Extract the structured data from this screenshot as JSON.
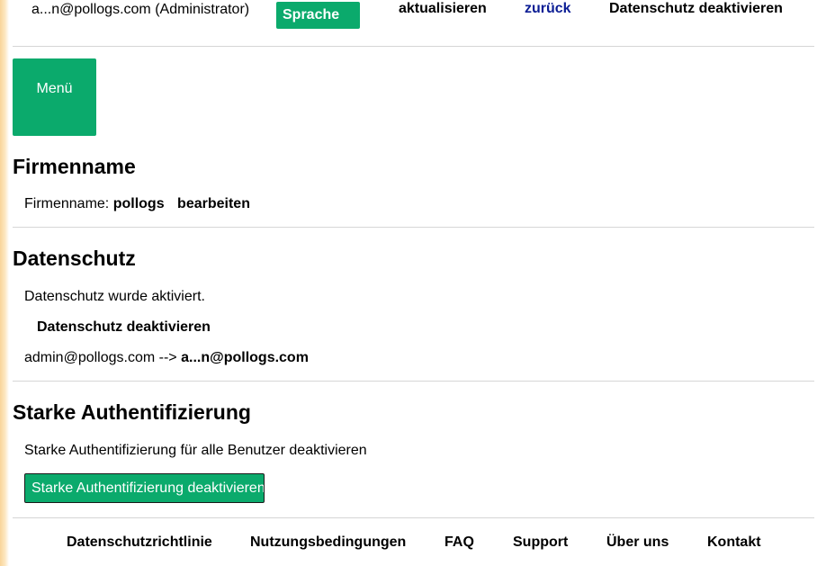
{
  "header": {
    "user_label": "a...n@pollogs.com (Administrator)",
    "language_button": "Sprache",
    "refresh_link": "aktualisieren",
    "back_link": "zurück",
    "privacy_deactivate_link": "Datenschutz deaktivieren"
  },
  "menu": {
    "button_label": "Menü"
  },
  "company": {
    "heading": "Firmenname",
    "label": "Firmenname:",
    "value": "pollogs",
    "edit_link": "bearbeiten"
  },
  "privacy": {
    "heading": "Datenschutz",
    "status_text": "Datenschutz wurde aktiviert.",
    "deactivate_link": "Datenschutz deaktivieren",
    "mapping_original": "admin@pollogs.com -->",
    "mapping_masked": "a...n@pollogs.com"
  },
  "strong_auth": {
    "heading": "Starke Authentifizierung",
    "description": "Starke Authentifizierung für alle Benutzer deaktivieren",
    "button_label": "Starke Authentifizierung deaktivieren"
  },
  "footer": {
    "links": [
      "Datenschutzrichtlinie",
      "Nutzungsbedingungen",
      "FAQ",
      "Support",
      "Über uns",
      "Kontakt"
    ]
  },
  "colors": {
    "accent_green": "#0baa6c",
    "link_blue": "#0b1d94",
    "divider": "#d6d6d6"
  }
}
